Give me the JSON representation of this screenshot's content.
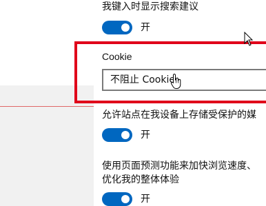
{
  "settings": {
    "search_suggest": {
      "label": "我键入时显示搜索建议",
      "toggle_state": "开"
    },
    "cookie": {
      "title": "Cookie",
      "selected": "不阻止 Cookie"
    },
    "protected_media": {
      "label": "允许站点在我设备上存储受保护的媒",
      "toggle_state": "开"
    },
    "page_prediction": {
      "label_line1": "使用页面预测功能来加快浏览速度、",
      "label_line2": "优化我的整体体验",
      "toggle_state": "开"
    }
  },
  "colors": {
    "toggle_on": "#0067c0",
    "highlight": "#e0001a"
  },
  "icons": {
    "arrow_cursor": "arrow-cursor-icon",
    "hand_cursor": "hand-pointer-icon"
  }
}
